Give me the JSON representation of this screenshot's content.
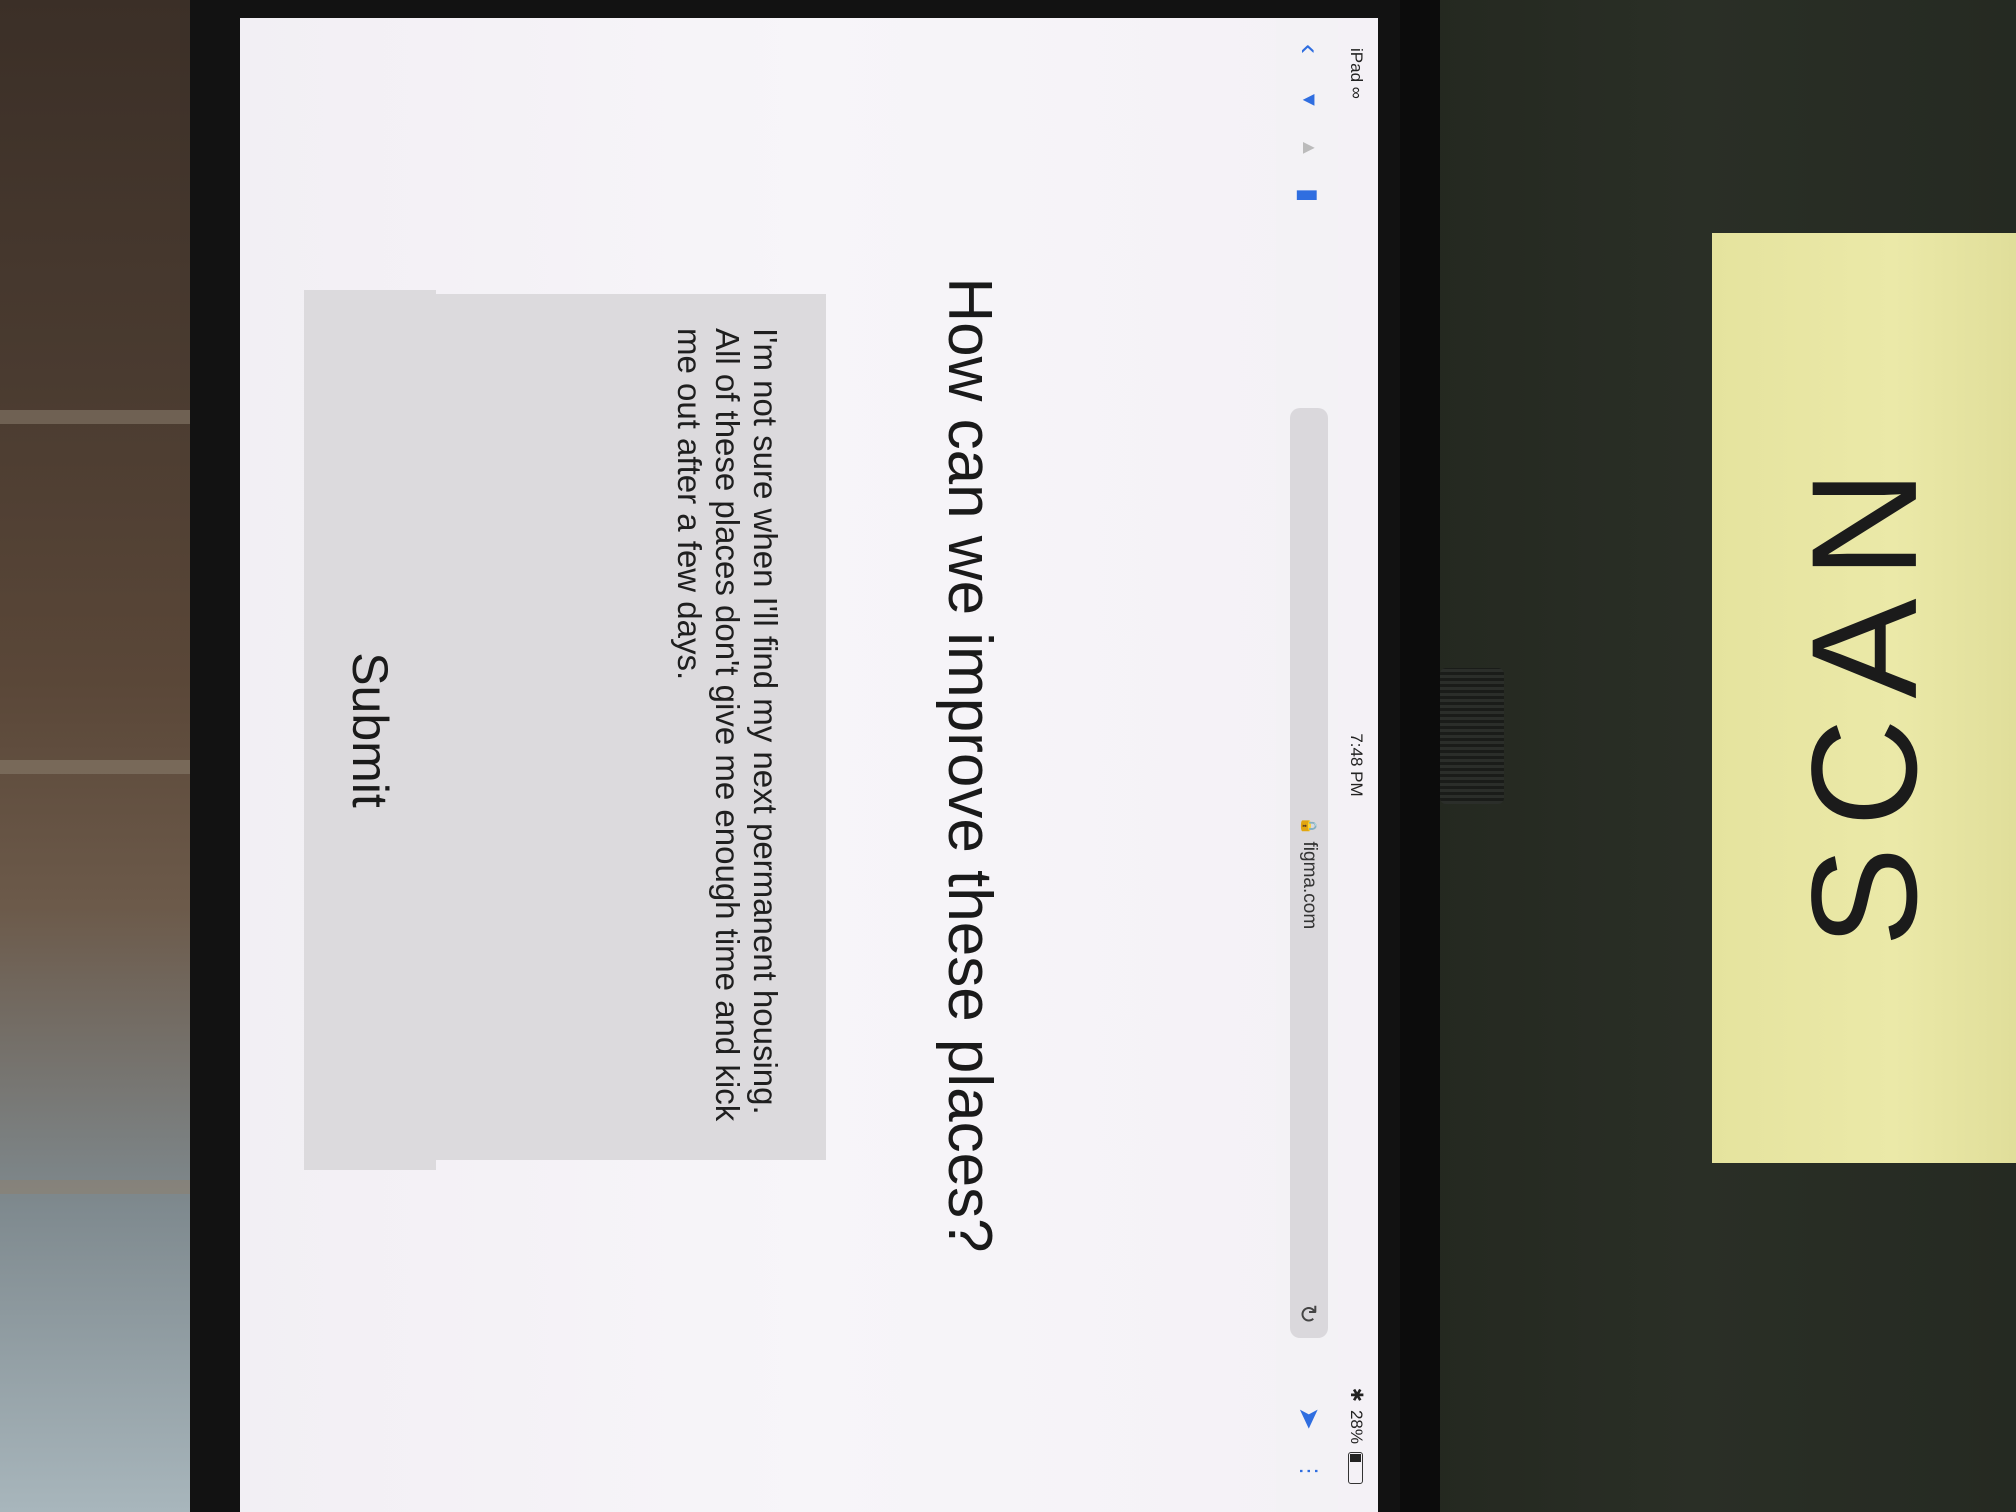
{
  "status_bar": {
    "device": "iPad",
    "time": "7:48 PM",
    "battery": "28%",
    "battery_level": 0.28
  },
  "browser": {
    "url": "figma.com"
  },
  "page": {
    "question": "How can we improve these places?",
    "answer": "I'm not sure when I'll find my next permanent housing. All of these places don't give me enough time and kick me out after a few days.",
    "submit_label": "Submit"
  },
  "sign": {
    "text": "SCAN"
  },
  "icons": [
    "back-chevron-icon",
    "forward-icon",
    "bookmarks-icon",
    "lock-icon",
    "reload-icon",
    "share-icon",
    "more-icon",
    "wifi-icon",
    "bluetooth-icon",
    "battery-icon"
  ],
  "colors": {
    "accent": "#2f6ee0",
    "screen_bg": "#f4f1f6",
    "field_bg": "#dcdadd",
    "sign_bg": "#e8e6a4"
  }
}
